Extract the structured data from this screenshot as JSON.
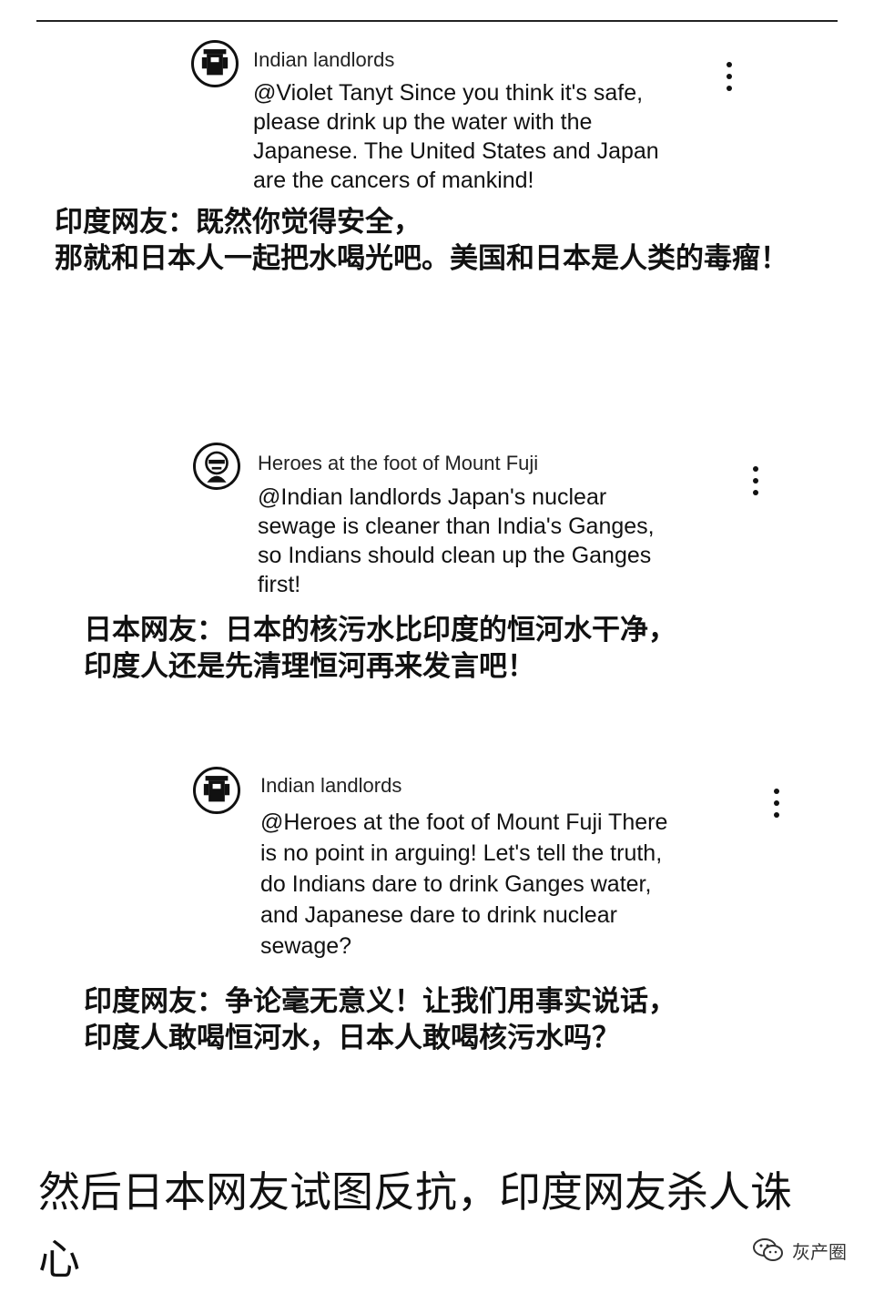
{
  "comments": [
    {
      "author": "Indian landlords",
      "text": "@Violet Tanyt Since you think it's safe,\nplease drink up the water with the\nJapanese. The United States and Japan\nare the cancers of mankind!",
      "translation": "印度网友：既然你觉得安全，\n那就和日本人一起把水喝光吧。美国和日本是人类的毒瘤！",
      "avatar_icon": "figure-avatar-icon",
      "menu_icon": "more-vertical-icon"
    },
    {
      "author": "Heroes at the foot of Mount Fuji",
      "text": "@Indian landlords Japan's nuclear\nsewage is cleaner than India's Ganges,\nso Indians should clean up the Ganges\nfirst!",
      "translation": "日本网友：日本的核污水比印度的恒河水干净，\n印度人还是先清理恒河再来发言吧！",
      "avatar_icon": "face-avatar-icon",
      "menu_icon": "more-vertical-icon"
    },
    {
      "author": "Indian landlords",
      "text": "@Heroes at the foot of Mount Fuji There\nis no point in arguing! Let's tell the truth,\ndo Indians dare to drink Ganges water,\nand Japanese dare to drink nuclear\nsewage?",
      "translation": "印度网友：争论毫无意义！让我们用事实说话，\n印度人敢喝恒河水，日本人敢喝核污水吗？",
      "avatar_icon": "figure-avatar-icon",
      "menu_icon": "more-vertical-icon"
    }
  ],
  "caption": "然后日本网友试图反抗，印度网友杀人诛心",
  "watermark": {
    "icon": "wechat-icon",
    "text": "灰产圈"
  }
}
